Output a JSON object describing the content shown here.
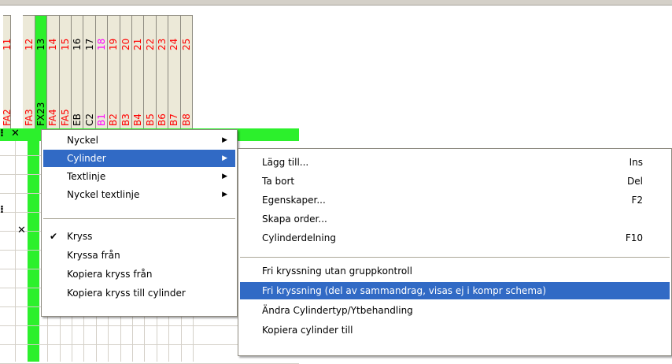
{
  "columns": [
    {
      "num": "11",
      "code": "FA2",
      "color": "#ff0000"
    },
    {
      "num": "12",
      "code": "FA3",
      "color": "#ff0000"
    },
    {
      "num": "13",
      "code": "FX23",
      "color": "#000000",
      "active": true
    },
    {
      "num": "14",
      "code": "FA4",
      "color": "#ff0000"
    },
    {
      "num": "15",
      "code": "FA5",
      "color": "#ff0000"
    },
    {
      "num": "16",
      "code": "EB",
      "color": "#000000"
    },
    {
      "num": "17",
      "code": "C2",
      "color": "#000000"
    },
    {
      "num": "18",
      "code": "B1",
      "color": "#ff00ff"
    },
    {
      "num": "19",
      "code": "B2",
      "color": "#ff0000"
    },
    {
      "num": "20",
      "code": "B3",
      "color": "#ff0000"
    },
    {
      "num": "21",
      "code": "B4",
      "color": "#ff0000"
    },
    {
      "num": "22",
      "code": "B5",
      "color": "#ff0000"
    },
    {
      "num": "23",
      "code": "B6",
      "color": "#ff0000"
    },
    {
      "num": "24",
      "code": "B7",
      "color": "#ff0000"
    },
    {
      "num": "25",
      "code": "B8",
      "color": "#ff0000"
    }
  ],
  "marks": {
    "x": "✕",
    "partial": "⁝"
  },
  "context_menu": {
    "items": [
      {
        "label": "Nyckel",
        "submenu": true
      },
      {
        "label": "Cylinder",
        "submenu": true,
        "highlighted": true
      },
      {
        "label": "Textlinje",
        "submenu": true
      },
      {
        "label": "Nyckel textlinje",
        "submenu": true
      },
      {
        "label": "Kryss",
        "checked": true
      },
      {
        "label": "Kryssa från"
      },
      {
        "label": "Kopiera kryss från"
      },
      {
        "label": "Kopiera kryss till cylinder"
      }
    ],
    "arrow": "▶",
    "check": "✔"
  },
  "submenu": {
    "items": [
      {
        "label": "Lägg till...",
        "shortcut": "Ins"
      },
      {
        "label": "Ta bort",
        "shortcut": "Del"
      },
      {
        "label": "Egenskaper...",
        "shortcut": "F2"
      },
      {
        "label": "Skapa order...",
        "shortcut": ""
      },
      {
        "label": "Cylinderdelning",
        "shortcut": "F10"
      },
      {
        "label": "Fri kryssning utan gruppkontroll",
        "shortcut": ""
      },
      {
        "label": "Fri kryssning (del av sammandrag, visas ej i kompr schema)",
        "shortcut": "",
        "highlighted": true
      },
      {
        "label": "Ändra Cylindertyp/Ytbehandling",
        "shortcut": ""
      },
      {
        "label": "Kopiera cylinder till",
        "shortcut": ""
      }
    ]
  },
  "colors": {
    "highlight": "#316ac5",
    "green": "#2cf02c",
    "header_bg": "#ece9d8"
  }
}
